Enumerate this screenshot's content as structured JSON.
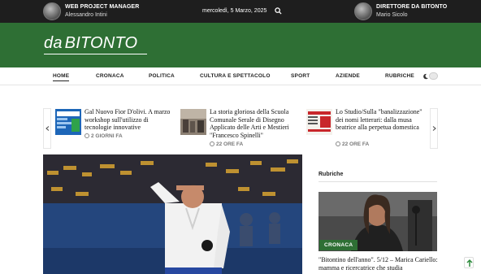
{
  "topbar": {
    "left": {
      "role": "WEB PROJECT MANAGER",
      "name": "Alessandro Intini"
    },
    "date": "mercoledì, 5 Marzo, 2025",
    "right": {
      "role": "DIRETTORE DA BITONTO",
      "name": "Mario Sicolo"
    },
    "search_icon": "search-icon"
  },
  "header": {
    "logo_prefix": "da",
    "logo_main": "BITONTO",
    "background": "#2e6f34"
  },
  "nav": {
    "items": [
      {
        "label": "HOME"
      },
      {
        "label": "CRONACA"
      },
      {
        "label": "POLITICA"
      },
      {
        "label": "CULTURA E SPETTACOLO"
      },
      {
        "label": "SPORT"
      },
      {
        "label": "AZIENDE"
      },
      {
        "label": "RUBRICHE"
      }
    ],
    "dark_mode_icon": "moon-icon"
  },
  "carousel": {
    "prev_icon": "chevron-left-icon",
    "next_icon": "chevron-right-icon",
    "cards": [
      {
        "title": "Gal Nuovo Fior D'olivi. A marzo workshop sull'utilizzo di tecnologie innovative",
        "time": "2 GIORNI FA"
      },
      {
        "title": "La storia gloriosa della Scuola Comunale Serale di Disegno Applicato delle Arti e Mestieri \"Francesco Spinelli\"",
        "time": "22 ORE FA"
      },
      {
        "title": "Lo Studio/Sulla \"banalizzazione\" dei nomi letterari: dalla musa beatrice alla perpetua domestica",
        "time": "22 ORE FA"
      }
    ]
  },
  "sidebar": {
    "title": "Rubriche",
    "badge": "CRONACA",
    "headline": "\"Bitontino dell'anno\". 5/12 – Marica Cariello: mamma e ricercatrice che studia"
  },
  "scroll_top_icon": "arrow-up-icon"
}
